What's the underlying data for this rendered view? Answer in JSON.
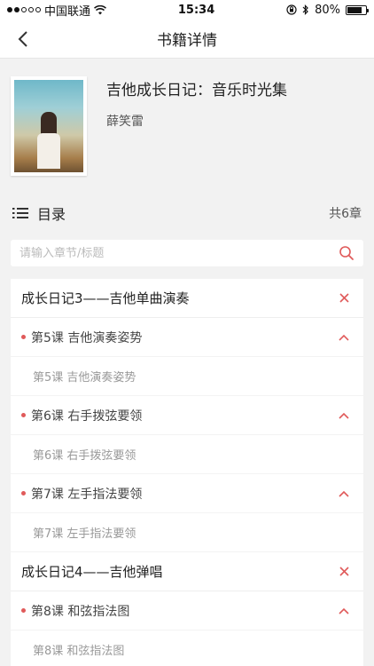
{
  "status_bar": {
    "carrier": "中国联通",
    "time": "15:34",
    "battery": "80%",
    "battery_level": 0.8
  },
  "nav": {
    "title": "书籍详情"
  },
  "book": {
    "title": "吉他成长日记：音乐时光集",
    "author": "薛笑雷"
  },
  "toc": {
    "label": "目录",
    "count": "共6章"
  },
  "search": {
    "placeholder": "请输入章节/标题"
  },
  "chapters": [
    {
      "title": "成长日记3——吉他单曲演奏",
      "lessons": [
        {
          "title": "第5课 吉他演奏姿势",
          "sub": "第5课 吉他演奏姿势"
        },
        {
          "title": "第6课 右手拨弦要领",
          "sub": "第6课 右手拨弦要领"
        },
        {
          "title": "第7课 左手指法要领",
          "sub": "第7课 左手指法要领"
        }
      ]
    },
    {
      "title": "成长日记4——吉他弹唱",
      "lessons": [
        {
          "title": "第8课 和弦指法图",
          "sub": "第8课 和弦指法图"
        }
      ]
    }
  ],
  "colors": {
    "accent": "#e05a5a",
    "background": "#f2f2f2"
  }
}
